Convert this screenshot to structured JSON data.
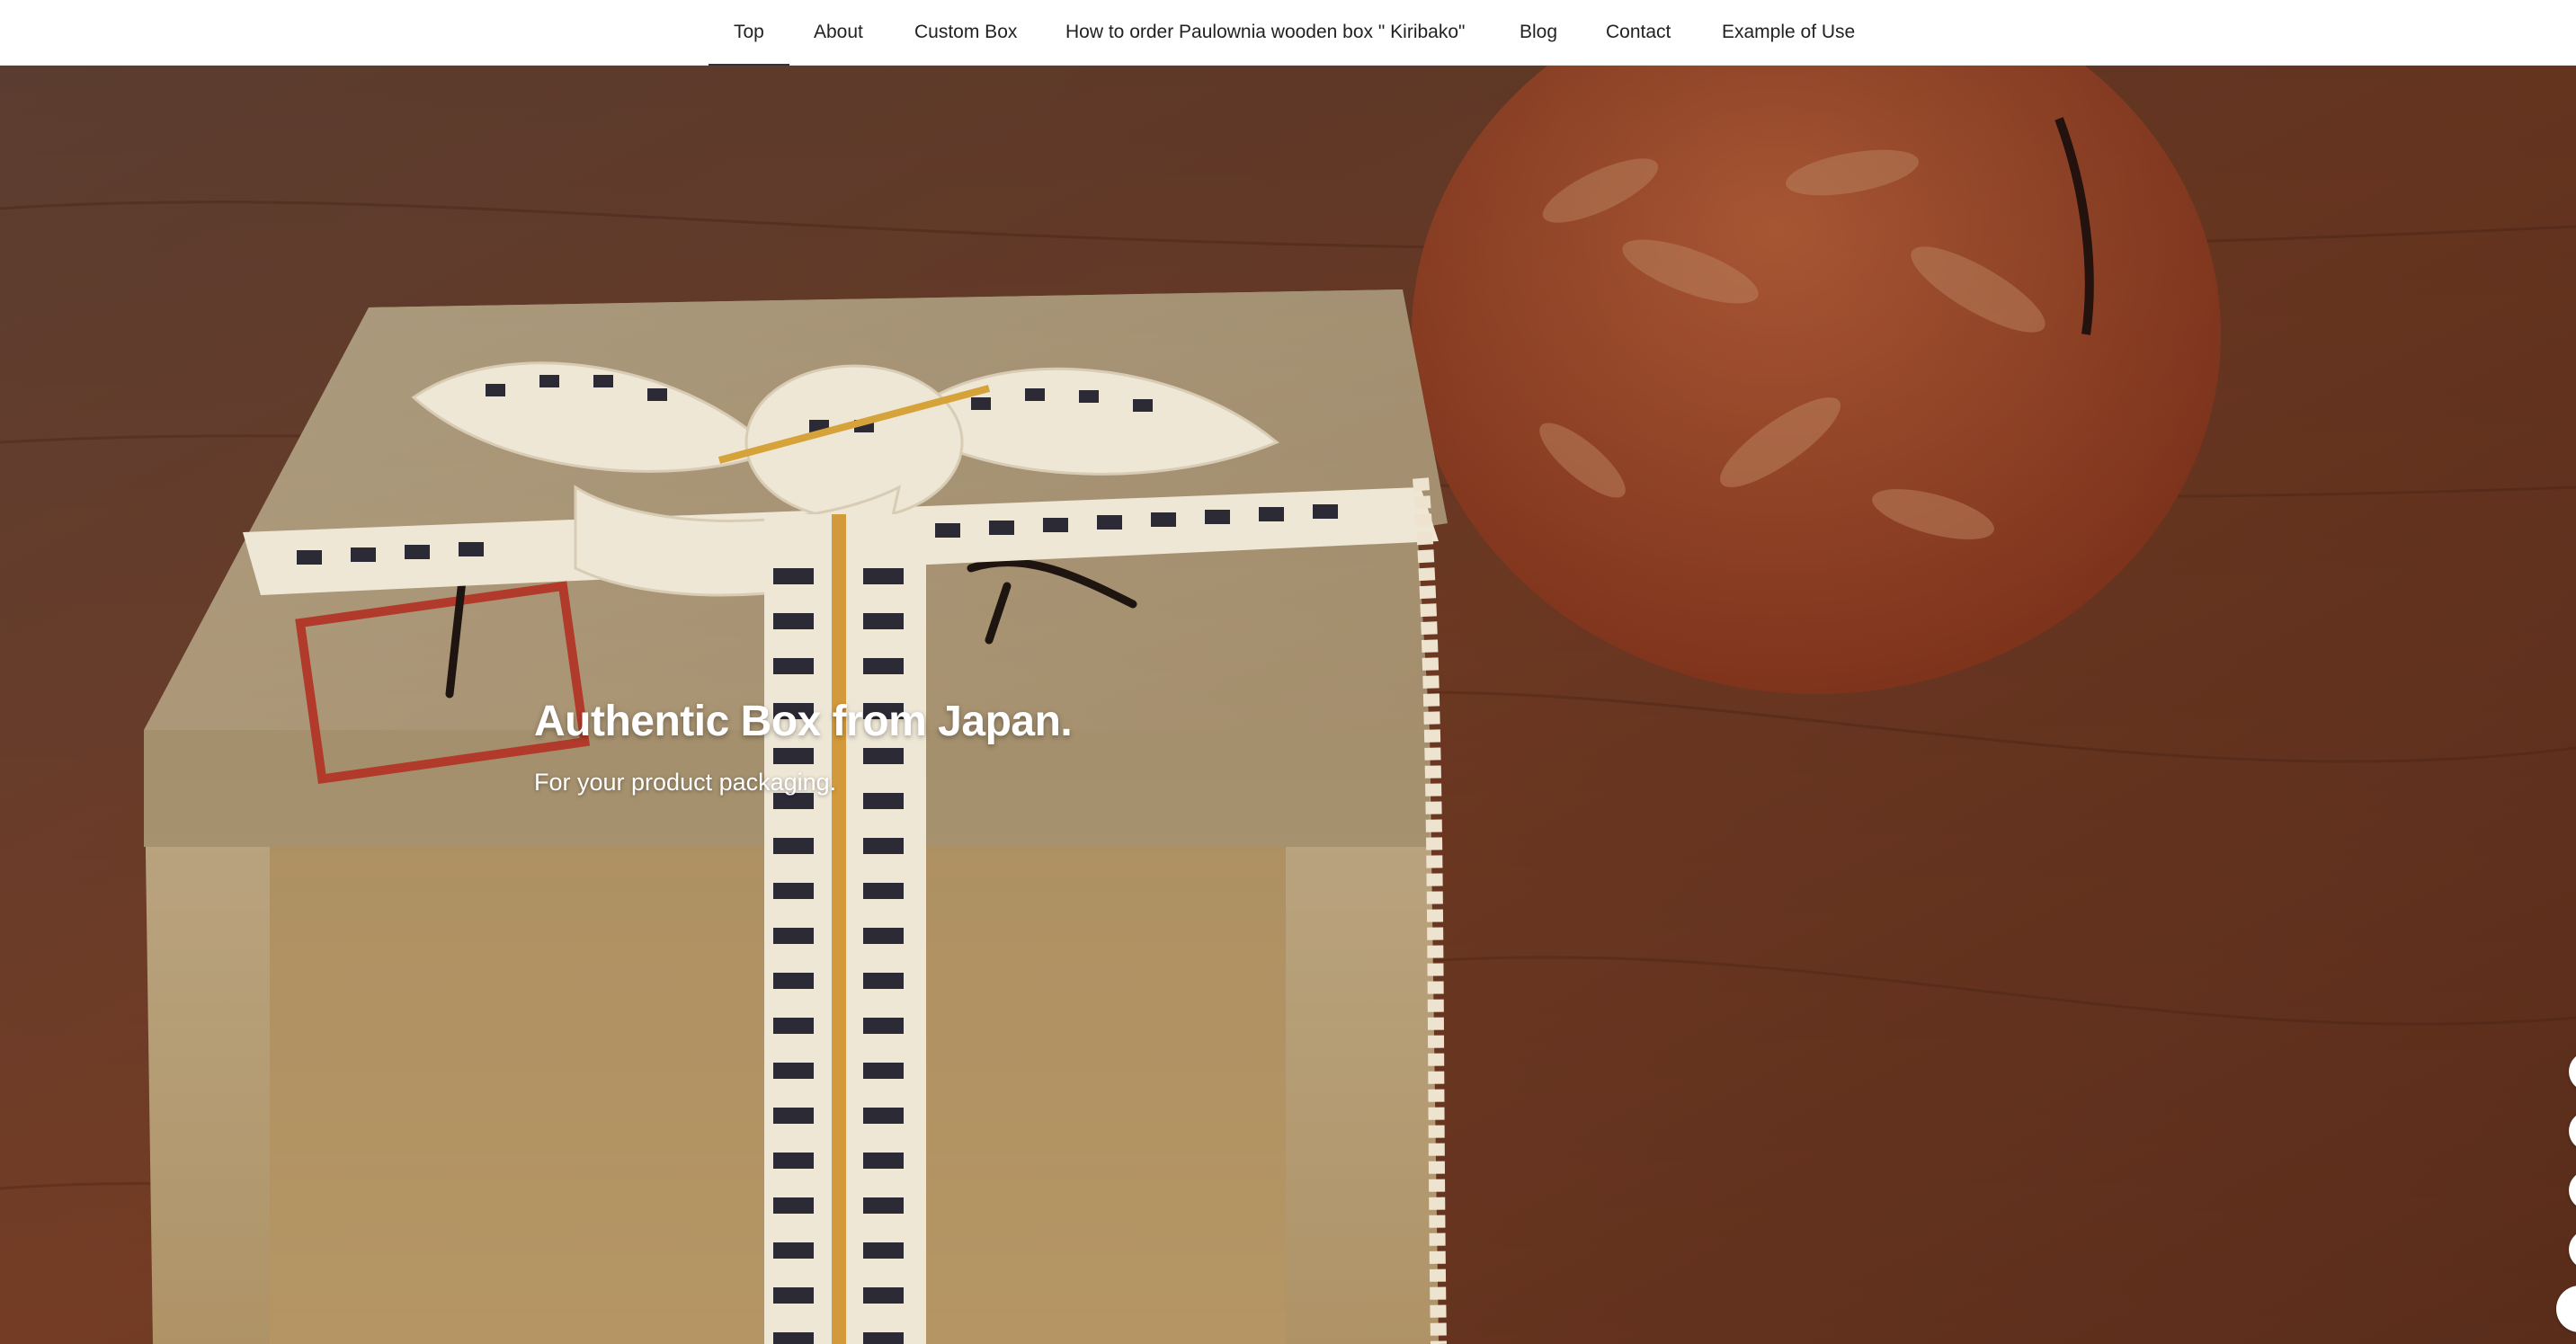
{
  "nav": {
    "items": [
      {
        "label": "Top",
        "active": true
      },
      {
        "label": "About"
      },
      {
        "label": "Custom Box"
      },
      {
        "label": "How to order Paulownia wooden box \" Kiribako\""
      },
      {
        "label": "Blog"
      },
      {
        "label": "Contact"
      },
      {
        "label": "Example of Use"
      }
    ]
  },
  "hero": {
    "title": "Authentic Box from Japan.",
    "subtitle": "For your product packaging."
  },
  "colors": {
    "nav_bg": "#ffffff",
    "nav_text": "#222222",
    "wood_floor": "#6b3a26",
    "box_wood": "#c9b38d",
    "cushion": "#b85a36"
  }
}
